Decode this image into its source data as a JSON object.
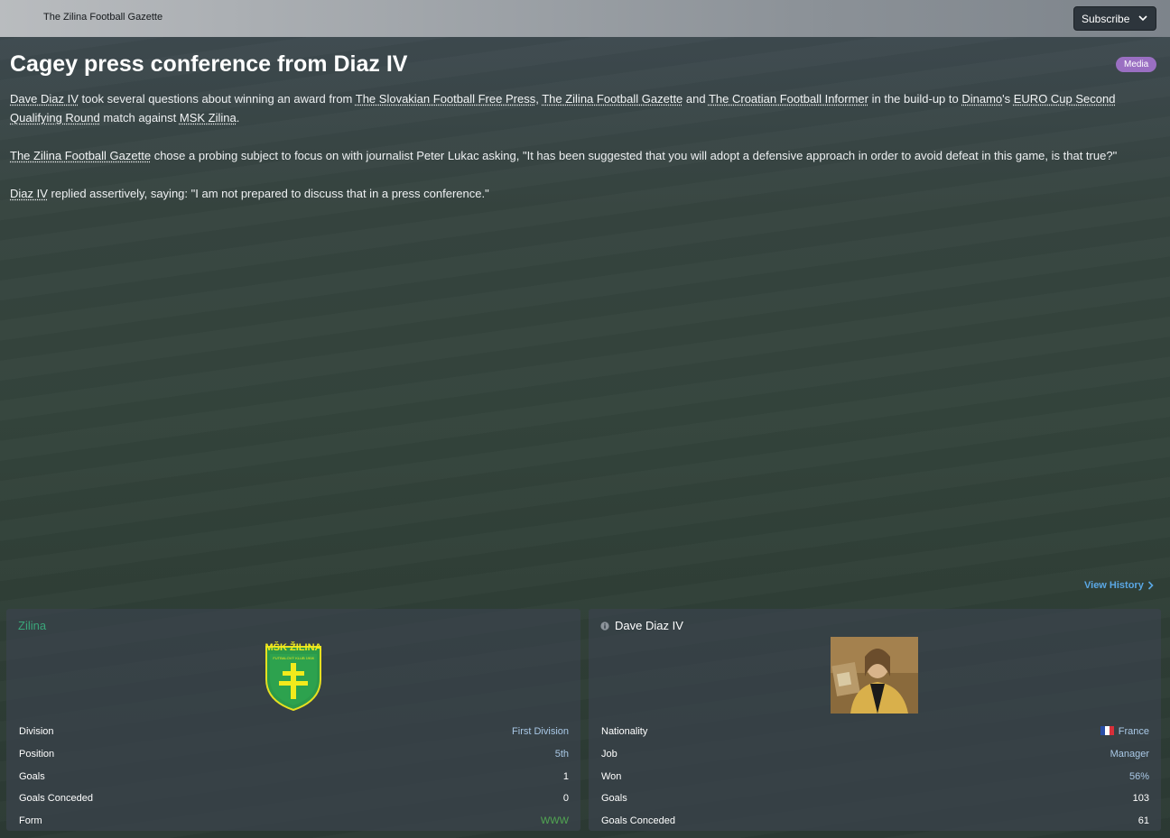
{
  "topbar": {
    "paper_name": "The Zilina Football Gazette",
    "subscribe_label": "Subscribe"
  },
  "article": {
    "headline": "Cagey press conference from Diaz IV",
    "badge": "Media",
    "p1": {
      "manager": "Dave Diaz IV",
      "t1": " took several questions about winning an award from ",
      "paper1": "The Slovakian Football Free Press",
      "t2": ", ",
      "paper2": "The Zilina Football Gazette",
      "t3": " and ",
      "paper3": "The Croatian Football Informer",
      "t4": " in the build-up to ",
      "club": "Dinamo",
      "t5": "'s ",
      "competition": "EURO Cup Second Qualifying Round",
      "t6": " match against ",
      "opponent": "MSK Zilina",
      "t7": "."
    },
    "p2": {
      "paper": "The Zilina Football Gazette",
      "t1": " chose a probing subject to focus on with journalist Peter Lukac asking, \"It has been suggested that you will adopt a defensive approach in order to avoid defeat in this game, is that true?\""
    },
    "p3": {
      "manager": "Diaz IV",
      "t1": " replied assertively, saying: \"I am not prepared to discuss that in a press conference.\""
    }
  },
  "view_history": "View History",
  "club_card": {
    "name": "Zilina",
    "crest_text": "MŠK ŽILINA",
    "crest_year": "FUTBALOVÝ KLUB 1908",
    "rows": [
      {
        "label": "Division",
        "value": "First Division"
      },
      {
        "label": "Position",
        "value": "5th"
      },
      {
        "label": "Goals",
        "value": "1"
      },
      {
        "label": "Goals Conceded",
        "value": "0"
      },
      {
        "label": "Form",
        "value": "WWW"
      }
    ]
  },
  "person_card": {
    "name": "Dave Diaz IV",
    "rows": [
      {
        "label": "Nationality",
        "value": "France"
      },
      {
        "label": "Job",
        "value": "Manager"
      },
      {
        "label": "Won",
        "value": "56%"
      },
      {
        "label": "Goals",
        "value": "103"
      },
      {
        "label": "Goals Conceded",
        "value": "61"
      }
    ]
  },
  "colors": {
    "accent_link": "#5aa7e4",
    "club_green": "#3aa67a",
    "form_green": "#52a852",
    "badge_purple": "#9a6fc2"
  }
}
